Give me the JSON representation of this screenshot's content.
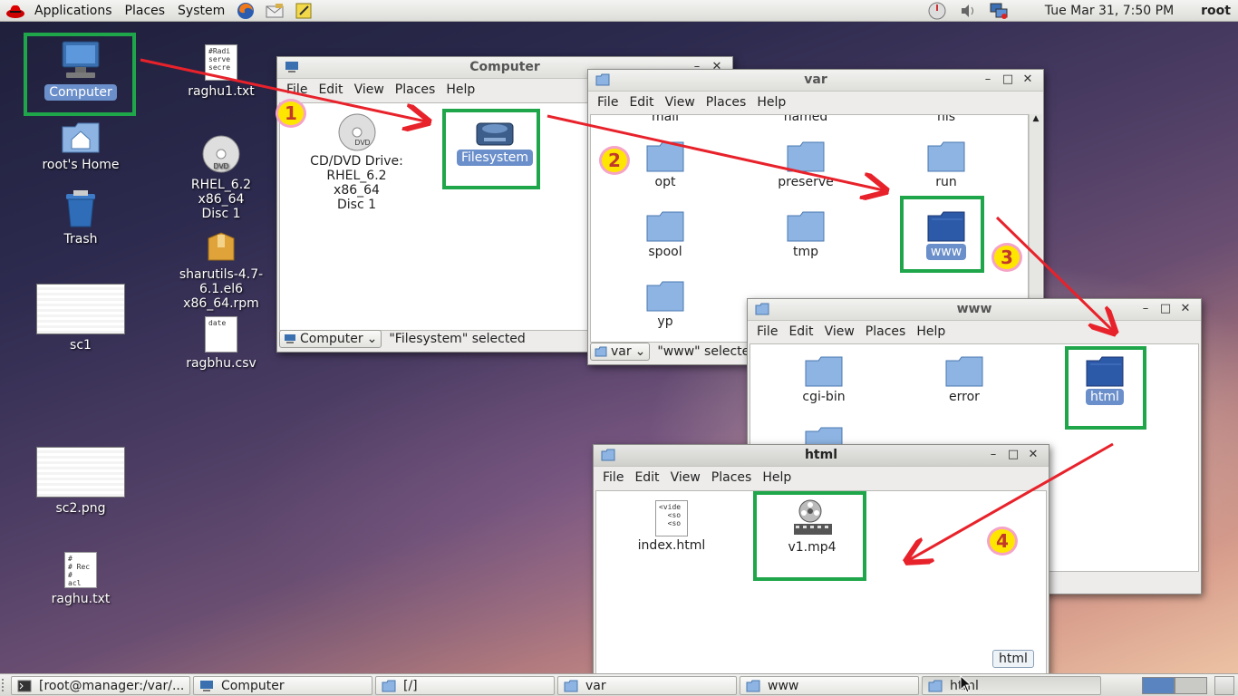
{
  "top_panel": {
    "menus": [
      "Applications",
      "Places",
      "System"
    ],
    "clock": "Tue Mar 31,  7:50 PM",
    "user": "root",
    "icons": [
      "redhat-logo-icon",
      "firefox-icon",
      "email-icon",
      "notes-icon",
      "power-icon",
      "volume-icon",
      "network-icon"
    ]
  },
  "desktop": {
    "computer": "Computer",
    "home": "root's Home",
    "trash": "Trash",
    "sc1": "sc1",
    "sc2": "sc2.png",
    "raghu": "raghu.txt",
    "raghu_preview": "#\n# Rec\n#\nacl ",
    "raghu1": "raghu1.txt",
    "raghu1_preview": "#Radi\nserve\nsecre",
    "rhel_line1": "RHEL_6.2 x86_64",
    "rhel_line2": "Disc 1",
    "sharutils_line1": "sharutils-4.7-6.1.el6",
    "sharutils_line2": "x86_64.rpm",
    "ragbhu": "ragbhu.csv",
    "ragbhu_preview": "date"
  },
  "menu": {
    "file": "File",
    "edit": "Edit",
    "view": "View",
    "places": "Places",
    "help": "Help"
  },
  "win_computer": {
    "title": "Computer",
    "items": {
      "dvd_line1": "CD/DVD Drive:",
      "dvd_line2": "RHEL_6.2 x86_64",
      "dvd_line3": "Disc 1",
      "filesystem": "Filesystem"
    },
    "combo": "Computer",
    "status": "\"Filesystem\" selected"
  },
  "win_var": {
    "title": "var",
    "partial": [
      "mail",
      "named",
      "nis"
    ],
    "items": [
      "opt",
      "preserve",
      "run",
      "spool",
      "tmp",
      "www",
      "yp"
    ],
    "combo": "var",
    "status": "\"www\" selected"
  },
  "win_www": {
    "title": "www",
    "items": [
      "cgi-bin",
      "error",
      "html"
    ]
  },
  "win_html": {
    "title": "html",
    "items": [
      "index.html",
      "v1.mp4"
    ],
    "index_preview": "<vide\n  <so\n  <so",
    "tooltip": "html"
  },
  "badges": [
    "1",
    "2",
    "3",
    "4"
  ],
  "taskbar": {
    "tasks": [
      "[root@manager:/var/...",
      "Computer",
      "[/]",
      "var",
      "www",
      "html"
    ]
  },
  "colors": {
    "highlight": "#1fa64a",
    "arrow": "#e8222b",
    "badge": "#ffe600",
    "selection": "#6b8fca"
  }
}
